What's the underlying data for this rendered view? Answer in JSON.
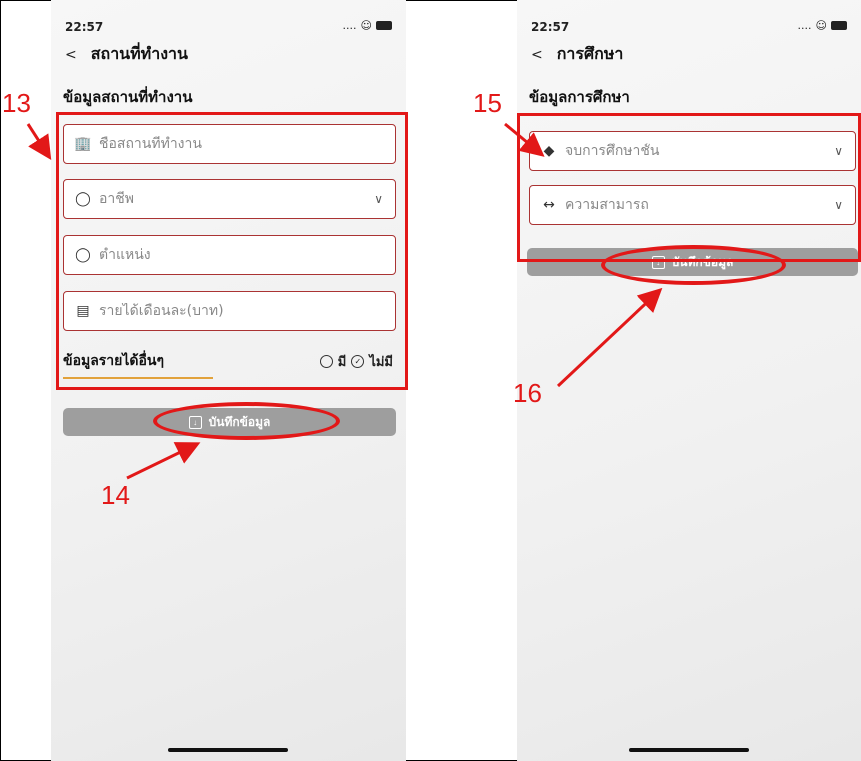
{
  "left_screen": {
    "status_time": "22:57",
    "status_signal": "....",
    "status_wifi": "wifi",
    "nav_back_glyph": "<",
    "nav_title": "สถานที่ทำงาน",
    "section_title": "ข้อมูลสถานที่ทำงาน",
    "fields": [
      {
        "placeholder": "ชื่อสถานที่ทำงาน",
        "icon": "building-icon"
      },
      {
        "placeholder": "อาชีพ",
        "icon": "user-icon",
        "dropdown": true
      },
      {
        "placeholder": "ตำแหน่ง",
        "icon": "user-icon"
      },
      {
        "placeholder": "รายได้เดือนละ(บาท)",
        "icon": "money-icon"
      }
    ],
    "income_label": "ข้อมูลรายได้อื่นๆ",
    "radio_yes": "มี",
    "radio_no": "ไม่มี",
    "radio_selected": "ไม่มี",
    "save_label": "บันทึกข้อมูล"
  },
  "right_screen": {
    "status_time": "22:57",
    "status_signal": "....",
    "nav_back_glyph": "<",
    "nav_title": "การศึกษา",
    "section_title": "ข้อมูลการศึกษา",
    "fields": [
      {
        "placeholder": "จบการศึกษาชั้น",
        "icon": "graduation-cap-icon",
        "dropdown": true
      },
      {
        "placeholder": "ความสามารถ",
        "icon": "arrows-horizontal-icon",
        "dropdown": true
      }
    ],
    "save_label": "บันทึกข้อมูล"
  },
  "callouts": {
    "c13": "13",
    "c14": "14",
    "c15": "15",
    "c16": "16"
  },
  "colors": {
    "annotation": "#e21818",
    "field_border": "#aa3333",
    "button": "#9e9e9e",
    "accent_underline": "#e2a23b"
  }
}
